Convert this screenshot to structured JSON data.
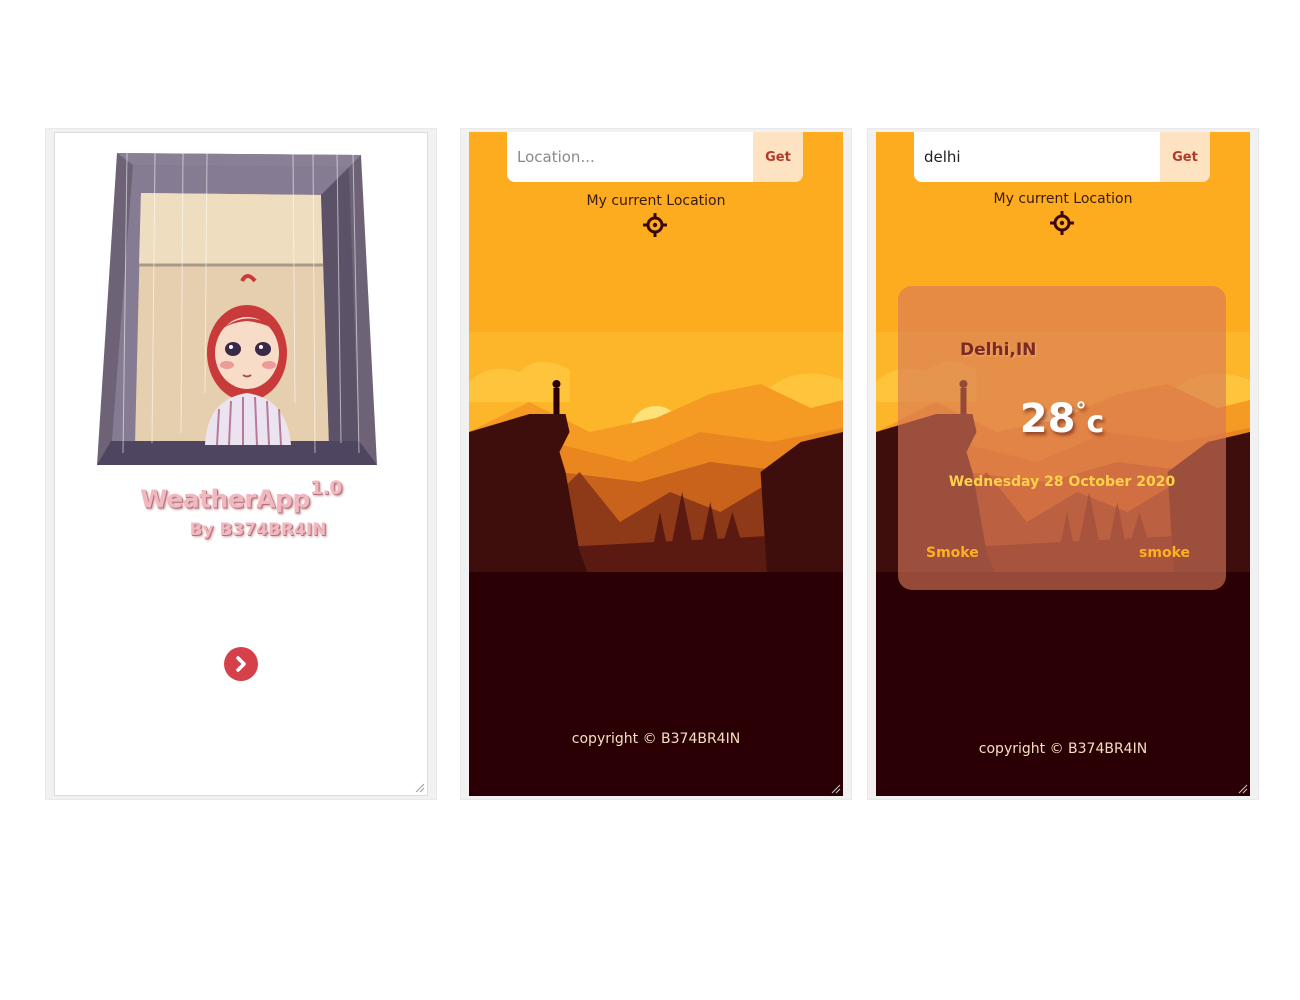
{
  "splash": {
    "title": "WeatherApp",
    "version": "1.0",
    "author": "By B374BR4IN",
    "next_icon": "chevron-right-icon"
  },
  "search_screen": {
    "input_value": "",
    "input_placeholder": "Location...",
    "get_label": "Get",
    "current_location_label": "My current Location",
    "location_icon": "crosshair-icon",
    "copyright": "copyright © B374BR4IN"
  },
  "result_screen": {
    "input_value": "delhi",
    "input_placeholder": "Location...",
    "get_label": "Get",
    "current_location_label": "My current Location",
    "location_icon": "crosshair-icon",
    "weather": {
      "city": "Delhi,IN",
      "temp_value": "28",
      "temp_degree": "°",
      "temp_unit": "c",
      "date": "Wednesday 28 October 2020",
      "condition_main": "Smoke",
      "condition_desc": "smoke"
    },
    "copyright": "copyright © B374BR4IN"
  },
  "colors": {
    "sky": "#fdab1f",
    "dark_ground": "#2a0004",
    "accent_red": "#d6404a",
    "title_pink": "#f1b8c0"
  }
}
